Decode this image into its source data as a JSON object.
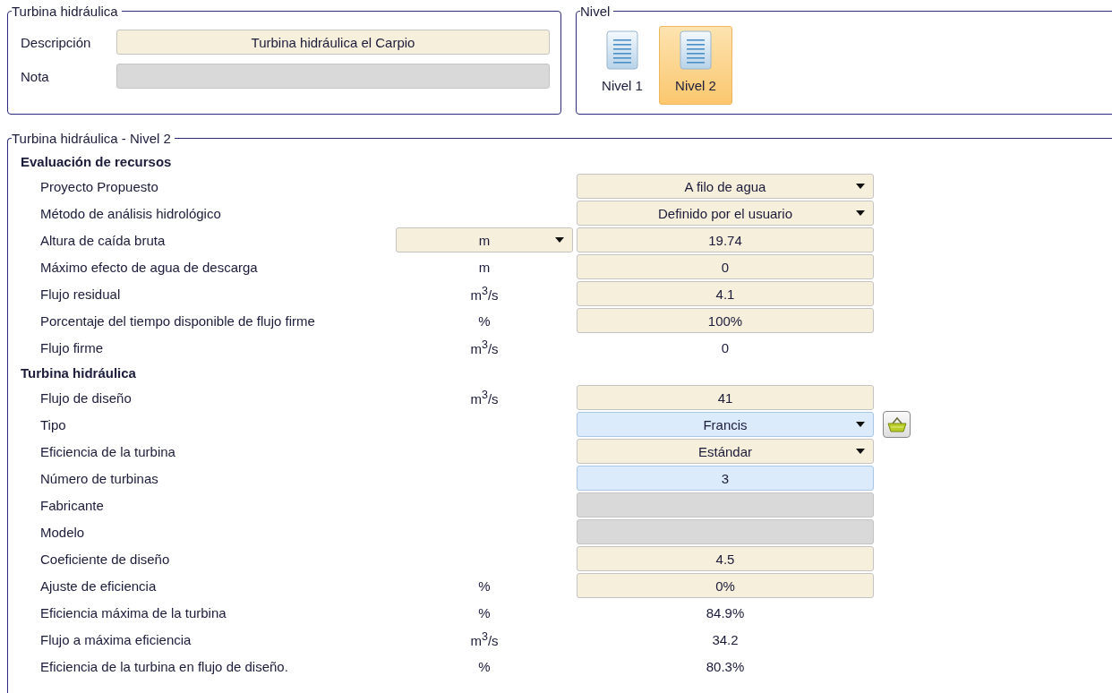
{
  "general": {
    "title": "Turbina hidráulica",
    "fields": [
      {
        "label": "Descripción",
        "value": "Turbina hidráulica el Carpio",
        "disabled": false
      },
      {
        "label": "Nota",
        "disabled": true
      }
    ]
  },
  "level": {
    "title": "Nivel",
    "options": [
      {
        "label": "Nivel 1",
        "selected": false
      },
      {
        "label": "Nivel 2",
        "selected": true
      }
    ]
  },
  "detail": {
    "title": "Turbina hidráulica - Nivel 2",
    "sections": [
      {
        "title": "Evaluación de recursos",
        "rows": [
          {
            "label": "Proyecto Propuesto",
            "field": {
              "kind": "dropdown",
              "value": "A filo de agua",
              "highlight": false
            }
          },
          {
            "label": "Método de análisis hidrológico",
            "field": {
              "kind": "dropdown",
              "value": "Definido por el usuario",
              "highlight": false
            }
          },
          {
            "label": "Altura de caída bruta",
            "unit": {
              "kind": "dropdown",
              "value": "m"
            },
            "field": {
              "kind": "input",
              "value": "19.74",
              "highlight": false
            }
          },
          {
            "label": "Máximo efecto de agua de descarga",
            "unit": {
              "kind": "text",
              "value": "m"
            },
            "field": {
              "kind": "input",
              "value": "0",
              "highlight": false
            }
          },
          {
            "label": "Flujo residual",
            "unit": {
              "kind": "text",
              "value": "m$^{3}$/s"
            },
            "field": {
              "kind": "input",
              "value": "4.1",
              "highlight": false
            }
          },
          {
            "label": "Porcentaje del tiempo disponible de flujo firme",
            "unit": {
              "kind": "text",
              "value": "%"
            },
            "field": {
              "kind": "input",
              "value": "100%",
              "highlight": false
            }
          },
          {
            "label": "Flujo firme",
            "unit": {
              "kind": "text",
              "value": "m$^{3}$/s"
            },
            "field": {
              "kind": "output",
              "value": "0"
            }
          }
        ]
      },
      {
        "title": "Turbina hidráulica",
        "rows": [
          {
            "label": "Flujo de diseño",
            "unit": {
              "kind": "text",
              "value": "m$^{3}$/s"
            },
            "field": {
              "kind": "input",
              "value": "41",
              "highlight": false
            }
          },
          {
            "label": "Tipo",
            "field": {
              "kind": "dropdown",
              "value": "Francis",
              "highlight": true
            },
            "side_button": true
          },
          {
            "label": "Eficiencia de la turbina",
            "field": {
              "kind": "dropdown",
              "value": "Estándar",
              "highlight": false
            }
          },
          {
            "label": "Número de turbinas",
            "field": {
              "kind": "input",
              "value": "3",
              "highlight": true
            }
          },
          {
            "label": "Fabricante",
            "field": {
              "kind": "disabled"
            }
          },
          {
            "label": "Modelo",
            "field": {
              "kind": "disabled"
            }
          },
          {
            "label": "Coeficiente de diseño",
            "field": {
              "kind": "input",
              "value": "4.5",
              "highlight": false
            }
          },
          {
            "label": "Ajuste de eficiencia",
            "unit": {
              "kind": "text",
              "value": "%"
            },
            "field": {
              "kind": "input",
              "value": "0%",
              "highlight": false
            }
          },
          {
            "label": "Eficiencia máxima de la turbina",
            "unit": {
              "kind": "text",
              "value": "%"
            },
            "field": {
              "kind": "output",
              "value": "84.9%"
            }
          },
          {
            "label": "Flujo a máxima eficiencia",
            "unit": {
              "kind": "text",
              "value": "m$^{3}$/s"
            },
            "field": {
              "kind": "output",
              "value": "34.2"
            }
          },
          {
            "label": "Eficiencia de la turbina en flujo de diseño.",
            "unit": {
              "kind": "text",
              "value": "%"
            },
            "field": {
              "kind": "output",
              "value": "80.3%"
            }
          }
        ]
      }
    ]
  }
}
